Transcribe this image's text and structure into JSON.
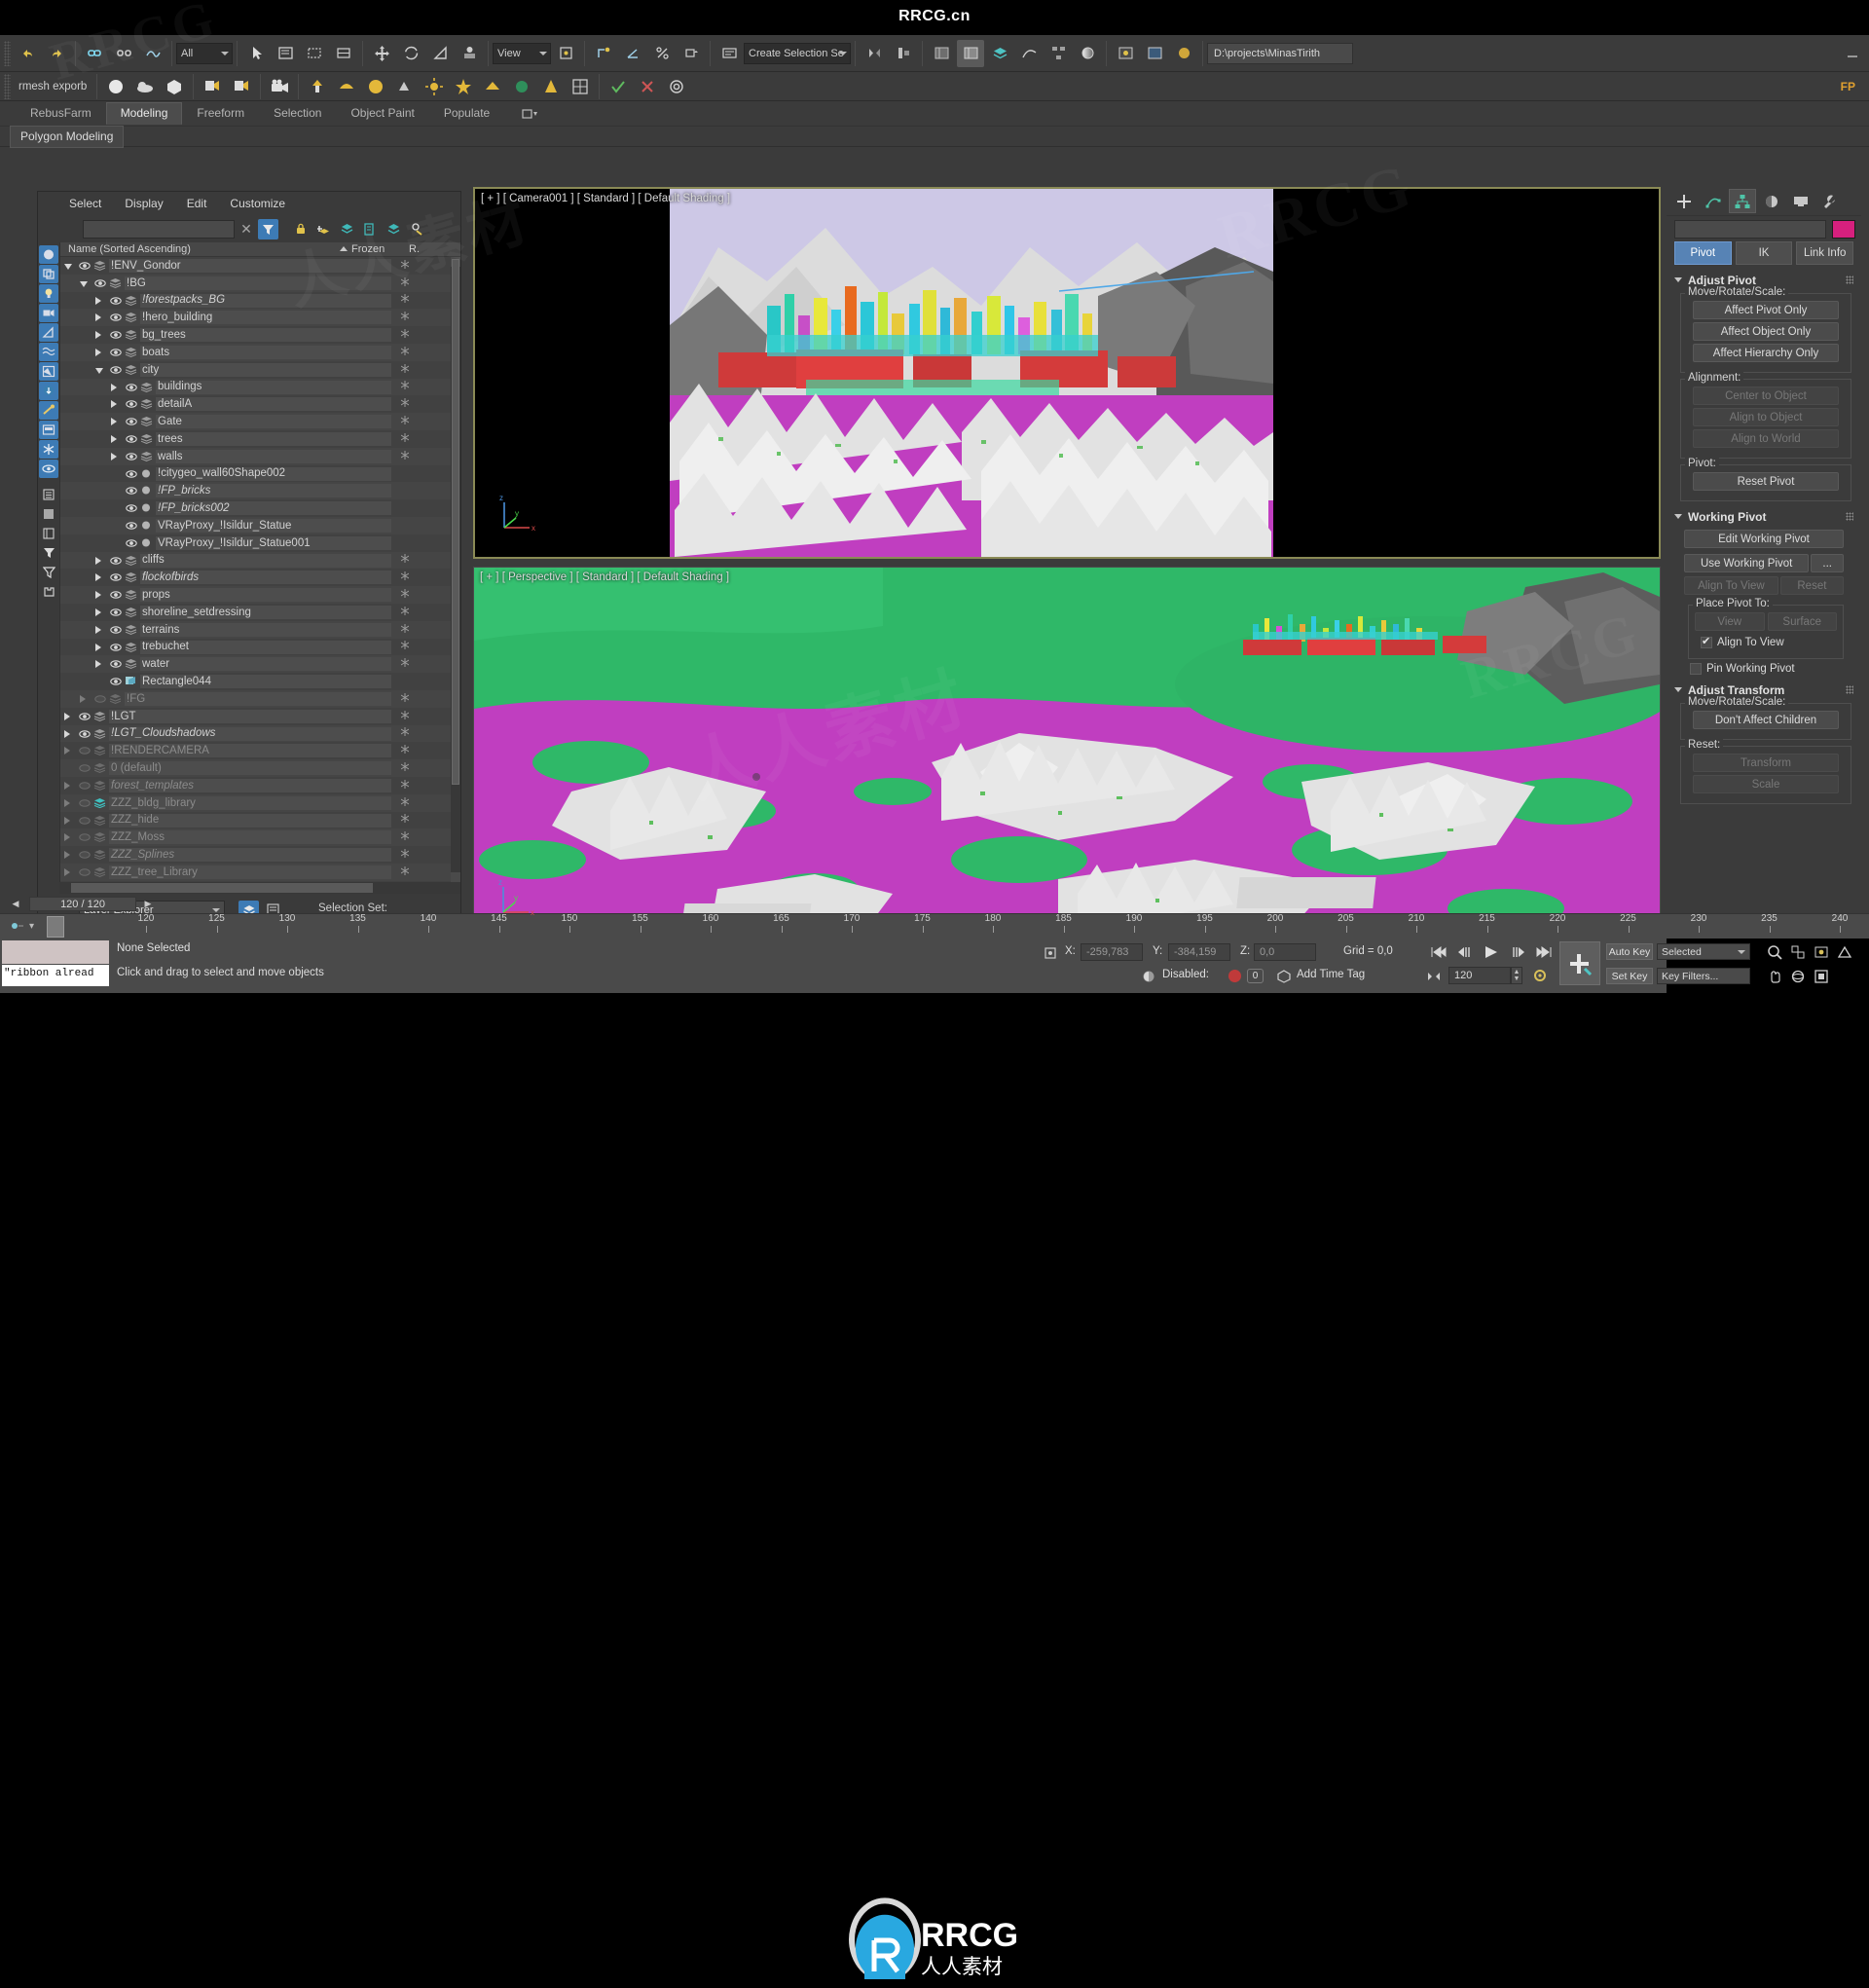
{
  "site": {
    "title": "RRCG.cn",
    "logo_text": "RRCG",
    "logo_sub": "人人素材"
  },
  "watermarks": [
    "RRCG",
    "人人素材",
    "RRCG",
    "人人素材",
    "RRCG"
  ],
  "toolbar": {
    "selection_filter": "All",
    "reference_coord": "View",
    "named_selection_set": "Create Selection Se",
    "project_path": "D:\\projects\\MinasTirith",
    "left_text": "rmesh exporb",
    "icons": [
      "undo-icon",
      "redo-icon",
      "select-link-icon",
      "unlink-icon",
      "bind-space-warp-icon",
      "select-object-icon",
      "select-region-icon",
      "window-crossing-icon",
      "select-move-icon",
      "select-rotate-icon",
      "select-scale-icon",
      "placement-icon",
      "ref-coord-icon",
      "use-center-icon",
      "snap-toggle-icon",
      "angle-snap-icon",
      "percent-snap-icon",
      "spinner-snap-icon",
      "edit-named-selection-icon",
      "mirror-icon",
      "align-icon",
      "layer-explorer-icon",
      "scene-explorer-icon",
      "ribbon-icon",
      "curve-editor-icon",
      "schematic-view-icon",
      "material-editor-icon",
      "render-setup-icon",
      "rendered-frame-icon",
      "render-production-icon"
    ],
    "icons2": [
      "mesh-export-icon",
      "material-sphere-icon",
      "cloud-icon",
      "box-icon",
      "render-frame-icon",
      "render-frame-cam-icon",
      "camera-icon",
      "light-icon",
      "teapot-icon",
      "sphere-icon",
      "paint-icon",
      "sun-icon",
      "star-icon",
      "plane-icon",
      "helix-icon",
      "cone-icon",
      "grid-icon",
      "check-icon",
      "cross-icon",
      "spiral-icon"
    ]
  },
  "ribbon": {
    "tabs": [
      {
        "label": "RebusFarm",
        "active": false
      },
      {
        "label": "Modeling",
        "active": true
      },
      {
        "label": "Freeform",
        "active": false
      },
      {
        "label": "Selection",
        "active": false
      },
      {
        "label": "Object Paint",
        "active": false
      },
      {
        "label": "Populate",
        "active": false
      }
    ],
    "subtab": "Polygon Modeling"
  },
  "explorer": {
    "menus": [
      "Select",
      "Display",
      "Edit",
      "Customize"
    ],
    "search_placeholder": "",
    "column_name": "Name (Sorted Ascending)",
    "column_frozen": "Frozen",
    "column_r": "R.",
    "mode_label": "Layer Explorer",
    "selection_set_label": "Selection Set:",
    "side_buttons": [
      "display-geometry-icon",
      "display-shapes-icon",
      "display-lights-icon",
      "display-cameras-icon",
      "display-helpers-icon",
      "display-spacewarps-icon",
      "display-groups-icon",
      "display-xrefs-icon",
      "display-bones-icon",
      "display-container-icon",
      "display-frozen-icon",
      "display-hidden-icon",
      "display-list-icon",
      "display-blank-icon",
      "display-columns-icon",
      "filter-selected-icon",
      "filter-icon",
      "container-icon"
    ],
    "tool_buttons": [
      "clear-search-icon",
      "filter-toggle-icon",
      "lock-icon",
      "add-layer-icon",
      "layers-icon",
      "layer-props-icon",
      "stack-icon",
      "select-layer-icon"
    ],
    "rows": [
      {
        "name": "!ENV_Gondor",
        "indent": 0,
        "arrow": "open",
        "icon": "layer",
        "eye": true,
        "style": "normal",
        "highlight": true
      },
      {
        "name": "!BG",
        "indent": 1,
        "arrow": "open",
        "icon": "layer",
        "eye": true,
        "style": "normal",
        "highlight": true
      },
      {
        "name": "!forestpacks_BG",
        "indent": 2,
        "arrow": "closed",
        "icon": "layer",
        "eye": true,
        "style": "italic",
        "highlight": true
      },
      {
        "name": "!hero_building",
        "indent": 2,
        "arrow": "closed",
        "icon": "layer",
        "eye": true,
        "style": "normal",
        "highlight": true
      },
      {
        "name": "bg_trees",
        "indent": 2,
        "arrow": "closed",
        "icon": "layer",
        "eye": true,
        "style": "normal",
        "highlight": true
      },
      {
        "name": "boats",
        "indent": 2,
        "arrow": "closed",
        "icon": "layer",
        "eye": true,
        "style": "normal",
        "highlight": true
      },
      {
        "name": "city",
        "indent": 2,
        "arrow": "open",
        "icon": "layer",
        "eye": true,
        "style": "normal",
        "highlight": true
      },
      {
        "name": "buildings",
        "indent": 3,
        "arrow": "closed",
        "icon": "layer",
        "eye": true,
        "style": "normal",
        "highlight": true
      },
      {
        "name": "detailA",
        "indent": 3,
        "arrow": "closed",
        "icon": "layer",
        "eye": true,
        "style": "normal",
        "highlight": true
      },
      {
        "name": "Gate",
        "indent": 3,
        "arrow": "closed",
        "icon": "layer",
        "eye": true,
        "style": "normal",
        "highlight": true
      },
      {
        "name": "trees",
        "indent": 3,
        "arrow": "closed",
        "icon": "layer",
        "eye": true,
        "style": "normal",
        "highlight": true
      },
      {
        "name": "walls",
        "indent": 3,
        "arrow": "closed",
        "icon": "layer",
        "eye": true,
        "style": "normal",
        "highlight": true
      },
      {
        "name": "!citygeo_wall60Shape002",
        "indent": 3,
        "arrow": "none",
        "icon": "object",
        "eye": true,
        "style": "normal",
        "highlight": true
      },
      {
        "name": "!FP_bricks",
        "indent": 3,
        "arrow": "none",
        "icon": "object",
        "eye": true,
        "style": "italic",
        "highlight": true
      },
      {
        "name": "!FP_bricks002",
        "indent": 3,
        "arrow": "none",
        "icon": "object",
        "eye": true,
        "style": "italic",
        "highlight": true
      },
      {
        "name": "VRayProxy_!Isildur_Statue",
        "indent": 3,
        "arrow": "none",
        "icon": "object",
        "eye": true,
        "style": "normal",
        "highlight": true
      },
      {
        "name": "VRayProxy_!Isildur_Statue001",
        "indent": 3,
        "arrow": "none",
        "icon": "object",
        "eye": true,
        "style": "normal",
        "highlight": true
      },
      {
        "name": "cliffs",
        "indent": 2,
        "arrow": "closed",
        "icon": "layer",
        "eye": true,
        "style": "normal",
        "highlight": true
      },
      {
        "name": "flockofbirds",
        "indent": 2,
        "arrow": "closed",
        "icon": "layer",
        "eye": true,
        "style": "italic",
        "highlight": true
      },
      {
        "name": "props",
        "indent": 2,
        "arrow": "closed",
        "icon": "layer",
        "eye": true,
        "style": "normal",
        "highlight": true
      },
      {
        "name": "shoreline_setdressing",
        "indent": 2,
        "arrow": "closed",
        "icon": "layer",
        "eye": true,
        "style": "normal",
        "highlight": true
      },
      {
        "name": "terrains",
        "indent": 2,
        "arrow": "closed",
        "icon": "layer",
        "eye": true,
        "style": "normal",
        "highlight": true
      },
      {
        "name": "trebuchet",
        "indent": 2,
        "arrow": "closed",
        "icon": "layer",
        "eye": true,
        "style": "normal",
        "highlight": true
      },
      {
        "name": "water",
        "indent": 2,
        "arrow": "closed",
        "icon": "layer",
        "eye": true,
        "style": "normal",
        "highlight": true
      },
      {
        "name": "Rectangle044",
        "indent": 2,
        "arrow": "none",
        "icon": "shape",
        "eye": true,
        "style": "normal",
        "highlight": true
      },
      {
        "name": "!FG",
        "indent": 1,
        "arrow": "closed",
        "icon": "layer",
        "eye": false,
        "style": "disabled",
        "highlight": true
      },
      {
        "name": "!LGT",
        "indent": 0,
        "arrow": "closed",
        "icon": "layer",
        "eye": true,
        "style": "normal",
        "highlight": true
      },
      {
        "name": "!LGT_Cloudshadows",
        "indent": 0,
        "arrow": "closed",
        "icon": "layer",
        "eye": true,
        "style": "italic",
        "highlight": true
      },
      {
        "name": "!RENDERCAMERA",
        "indent": 0,
        "arrow": "closed",
        "icon": "layer",
        "eye": false,
        "style": "disabled",
        "highlight": true
      },
      {
        "name": "0 (default)",
        "indent": 0,
        "arrow": "none",
        "icon": "layer",
        "eye": false,
        "style": "disabled",
        "highlight": true
      },
      {
        "name": "forest_templates",
        "indent": 0,
        "arrow": "closed",
        "icon": "layer",
        "eye": false,
        "style": "disabled-italic",
        "highlight": true
      },
      {
        "name": "ZZZ_bldg_library",
        "indent": 0,
        "arrow": "closed",
        "icon": "layer-teal",
        "eye": false,
        "style": "disabled",
        "highlight": true
      },
      {
        "name": "ZZZ_hide",
        "indent": 0,
        "arrow": "closed",
        "icon": "layer",
        "eye": false,
        "style": "disabled",
        "highlight": true
      },
      {
        "name": "ZZZ_Moss",
        "indent": 0,
        "arrow": "closed",
        "icon": "layer",
        "eye": false,
        "style": "disabled",
        "highlight": true
      },
      {
        "name": "ZZZ_Splines",
        "indent": 0,
        "arrow": "closed",
        "icon": "layer",
        "eye": false,
        "style": "disabled-italic",
        "highlight": true
      },
      {
        "name": "ZZZ_tree_Library",
        "indent": 0,
        "arrow": "closed",
        "icon": "layer",
        "eye": false,
        "style": "disabled",
        "highlight": true
      }
    ]
  },
  "viewports": {
    "top": {
      "label": "[ + ] [ Camera001 ] [ Standard ] [ Default Shading ]",
      "active": true
    },
    "bottom": {
      "label": "[ + ] [ Perspective ] [ Standard ] [ Default Shading ]",
      "active": false
    },
    "axis_labels": {
      "x": "x",
      "y": "y",
      "z": "z"
    }
  },
  "command_panel": {
    "tab_icons": [
      "create-tab-icon",
      "modify-tab-icon",
      "hierarchy-tab-icon",
      "motion-tab-icon",
      "display-tab-icon",
      "utilities-tab-icon"
    ],
    "object_name": "",
    "object_color": "#d6207e",
    "tabs": [
      {
        "label": "Pivot",
        "active": true
      },
      {
        "label": "IK",
        "active": false
      },
      {
        "label": "Link Info",
        "active": false
      }
    ],
    "rollouts": [
      {
        "title": "Adjust Pivot",
        "groups": [
          {
            "caption": "Move/Rotate/Scale:",
            "buttons": [
              {
                "label": "Affect Pivot Only",
                "disabled": false
              },
              {
                "label": "Affect Object Only",
                "disabled": false
              },
              {
                "label": "Affect Hierarchy Only",
                "disabled": false
              }
            ]
          },
          {
            "caption": "Alignment:",
            "buttons": [
              {
                "label": "Center to Object",
                "disabled": true
              },
              {
                "label": "Align to Object",
                "disabled": true
              },
              {
                "label": "Align to World",
                "disabled": true
              }
            ]
          },
          {
            "caption": "Pivot:",
            "buttons": [
              {
                "label": "Reset Pivot",
                "disabled": false
              }
            ]
          }
        ]
      },
      {
        "title": "Working Pivot",
        "buttons": [
          {
            "label": "Edit Working Pivot",
            "disabled": false
          }
        ],
        "row_use": [
          {
            "label": "Use Working Pivot",
            "disabled": false
          },
          {
            "label": "...",
            "disabled": false
          }
        ],
        "row_align": [
          {
            "label": "Align To View",
            "disabled": true
          },
          {
            "label": "Reset",
            "disabled": true
          }
        ],
        "place_group": {
          "caption": "Place Pivot To:",
          "buttons": [
            {
              "label": "View",
              "disabled": true
            },
            {
              "label": "Surface",
              "disabled": true
            }
          ],
          "checkbox": {
            "label": "Align To View",
            "checked": true
          }
        },
        "pin_checkbox": {
          "label": "Pin Working Pivot",
          "checked": false
        }
      },
      {
        "title": "Adjust Transform",
        "groups": [
          {
            "caption": "Move/Rotate/Scale:",
            "buttons": [
              {
                "label": "Don't Affect Children",
                "disabled": false
              }
            ]
          },
          {
            "caption": "Reset:",
            "buttons": [
              {
                "label": "Transform",
                "disabled": true
              },
              {
                "label": "Scale",
                "disabled": true
              }
            ]
          }
        ]
      }
    ]
  },
  "timebar": {
    "frame_counter": "120 / 120",
    "ticks": [
      120,
      125,
      130,
      135,
      140,
      145,
      150,
      155,
      160,
      165,
      170,
      175,
      180,
      185,
      190,
      195,
      200,
      205,
      210,
      215,
      220,
      225,
      230,
      235,
      240
    ]
  },
  "status": {
    "listener_text": "\"ribbon alread",
    "selection": "None Selected",
    "hint": "Click and drag to select and move objects",
    "coords": {
      "x_label": "X:",
      "x_value": "-259,783",
      "y_label": "Y:",
      "y_value": "-384,159",
      "z_label": "Z:",
      "z_value": "0,0"
    },
    "grid": "Grid = 0,0",
    "keylock": "Disabled:",
    "keylock_value": "0",
    "add_time_tag": "Add Time Tag",
    "current_frame": "120",
    "auto_key": "Auto Key",
    "set_key": "Set Key",
    "key_filters": "Key Filters...",
    "selected_combo": "Selected",
    "playback_icons": [
      "go-to-start-icon",
      "prev-frame-icon",
      "play-icon",
      "next-frame-icon",
      "go-to-end-icon"
    ],
    "nav_icons": [
      "zoom-icon",
      "zoom-all-icon",
      "zoom-extents-icon",
      "field-of-view-icon",
      "pan-icon",
      "orbit-icon",
      "maximize-viewport-icon"
    ]
  }
}
